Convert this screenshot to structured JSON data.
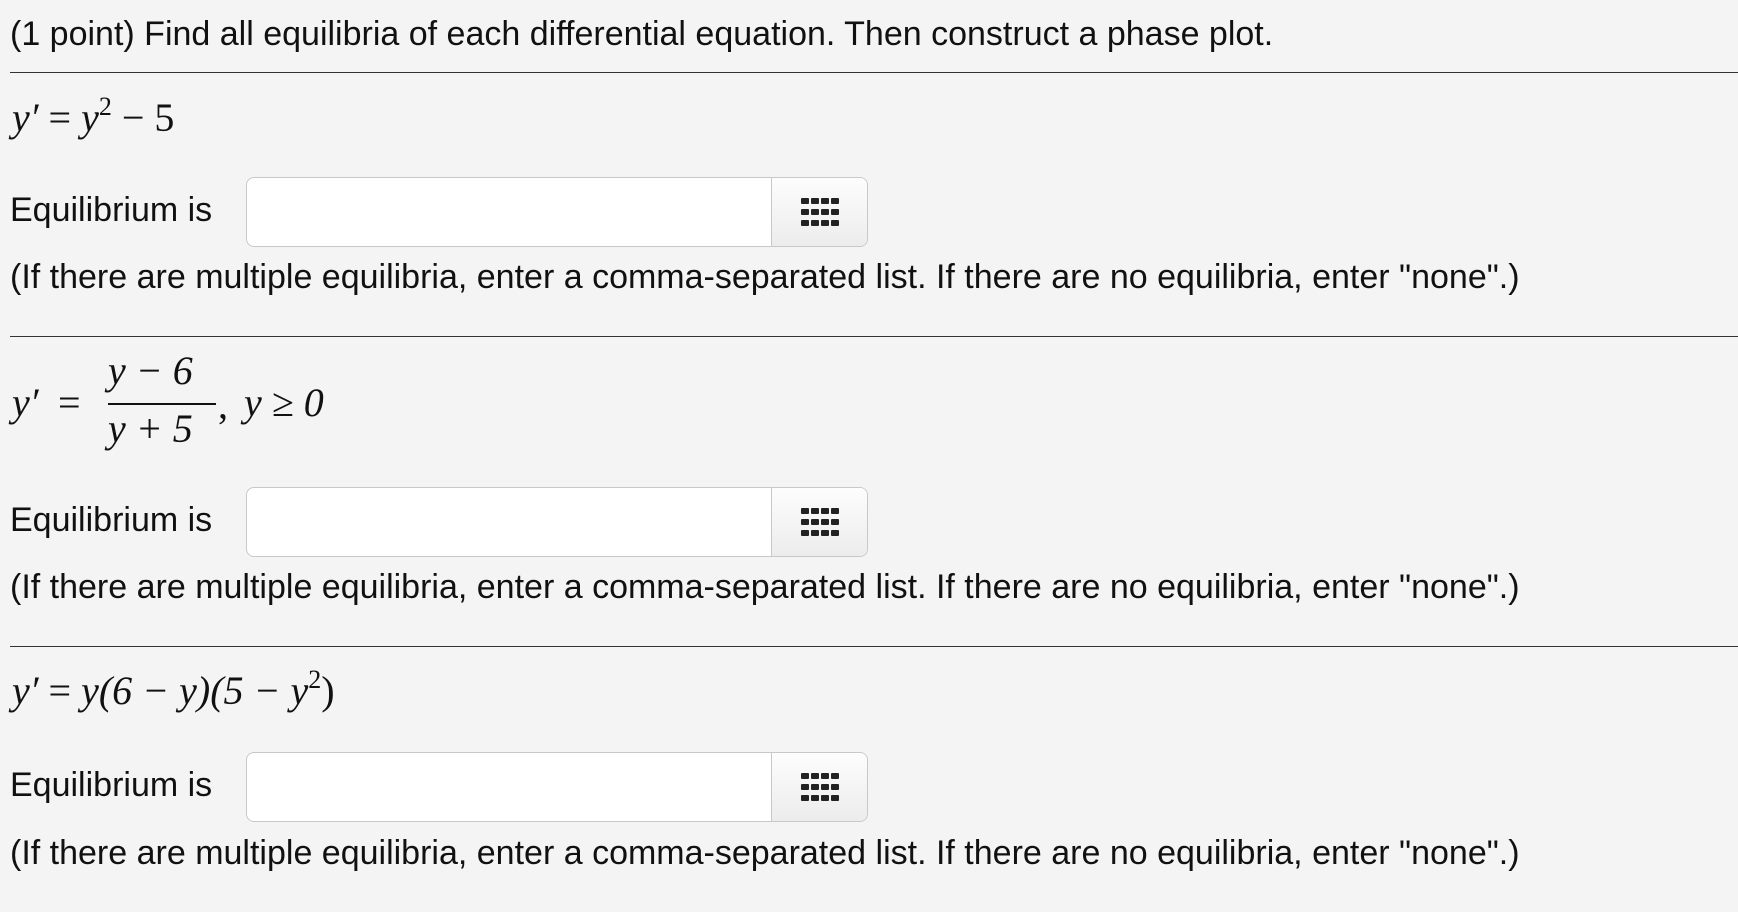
{
  "header": {
    "text": "(1 point) Find all equilibria of each differential equation. Then construct a phase plot."
  },
  "problems": [
    {
      "equation": {
        "lhs": "y′",
        "eq": "=",
        "var": "y",
        "exp": "2",
        "rest": " − 5"
      },
      "label": "Equilibrium is",
      "input_value": "",
      "hint": "(If there are multiple equilibria, enter a comma-separated list. If there are no equilibria, enter \"none\".)"
    },
    {
      "equation": {
        "lhs": "y′",
        "eq": "=",
        "numerator": "y − 6",
        "denominator": "y + 5",
        "comma": ",",
        "condition": "y ≥ 0"
      },
      "label": "Equilibrium is",
      "input_value": "",
      "hint": "(If there are multiple equilibria, enter a comma-separated list. If there are no equilibria, enter \"none\".)"
    },
    {
      "equation": {
        "lhs": "y′",
        "eq": "=",
        "part1": "y(6 − y)(5 − y",
        "exp": "2",
        "close": ")"
      },
      "label": "Equilibrium is",
      "input_value": "",
      "hint": "(If there are multiple equilibria, enter a comma-separated list. If there are no equilibria, enter \"none\".)"
    }
  ],
  "icons": {
    "picker": "grid-keypad-icon"
  }
}
